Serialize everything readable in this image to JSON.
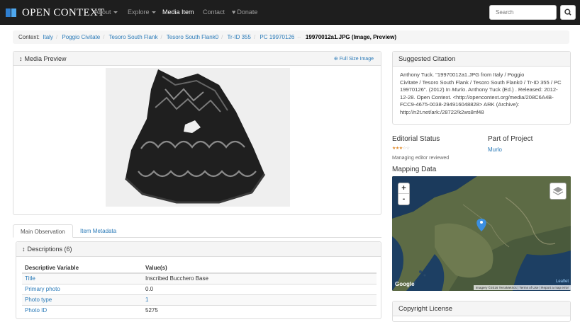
{
  "navbar": {
    "brand": "OPEN CONTEXT",
    "items": [
      "About",
      "Explore",
      "Media Item",
      "Contact",
      "Donate"
    ],
    "search_placeholder": "Search"
  },
  "breadcrumb": {
    "label": "Context:",
    "items": [
      "Italy",
      "Poggio Civitate",
      "Tesoro South Flank",
      "Tesoro South Flank0",
      "Tr-ID 355",
      "PC 19970126"
    ],
    "current": "19970012a1.JPG (Image, Preview)"
  },
  "media_preview": {
    "title": "Media Preview",
    "full_size_label": "Full Size Image"
  },
  "tabs": [
    "Main Observation",
    "Item Metadata"
  ],
  "descriptions": {
    "title": "Descriptions (6)",
    "columns": [
      "Descriptive Variable",
      "Value(s)"
    ],
    "rows": [
      [
        "Title",
        "Inscribed Bucchero Base"
      ],
      [
        "Primary photo",
        "0.0"
      ],
      [
        "Photo type",
        "1"
      ],
      [
        "Photo ID",
        "5275"
      ]
    ]
  },
  "citation": {
    "title": "Suggested Citation",
    "line1": "Anthony Tuck. \"19970012a1.JPG from Italy / Poggio",
    "line2": "Civitate / Tesoro South Flank / Tesoro South Flank0 / Tr-ID 355 / PC",
    "line3a": "19970126\". (2012) In ",
    "line3_em": "Murlo",
    "line3b": ". Anthony Tuck (Ed.) . Released: 2012-",
    "line4": "12-28. Open Context. <http://opencontext.org/media/208C6A4B-",
    "line5": "FCC9-4675-0038-294916048828> ARK (Archive):",
    "line6": "http://n2t.net/ark:/28722/k2ws8nf48"
  },
  "editorial": {
    "title": "Editorial Status",
    "stars_filled": 3,
    "stars_total": 5,
    "note": "Managing editor reviewed"
  },
  "project": {
    "title": "Part of Project",
    "name": "Murlo"
  },
  "mapping": {
    "title": "Mapping Data",
    "zoom_in": "+",
    "zoom_out": "-",
    "google": "Google",
    "leaflet": "Leaflet",
    "attribution": "Imagery ©2016 TerraMetrics | Terms of Use | Report a map error"
  },
  "copyright": {
    "title": "Copyright License"
  },
  "colors": {
    "navbar_bg": "#1e1e1e",
    "link": "#2a7ab8",
    "brand_blue": "#2f7fd1",
    "star_on": "#e08a2a",
    "map_marker": "#3b8fe0"
  }
}
